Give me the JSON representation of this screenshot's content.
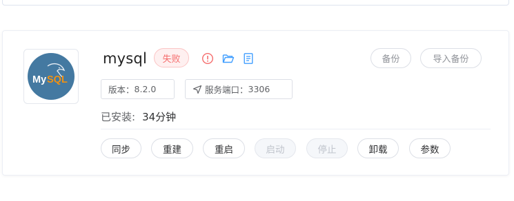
{
  "app": {
    "name": "mysql",
    "status": "失败",
    "logo_text": "MySQL",
    "version_label": "版本：",
    "version_value": "8.2.0",
    "port_label": "服务端口：",
    "port_value": "3306",
    "installed_label": "已安装:",
    "installed_value": "34分钟"
  },
  "header_buttons": {
    "backup": "备份",
    "import_backup": "导入备份"
  },
  "icons": {
    "error": "exclamation-circle-icon",
    "folder": "folder-open-icon",
    "document": "document-icon",
    "port": "location-arrow-icon"
  },
  "actions": [
    {
      "label": "同步",
      "disabled": false
    },
    {
      "label": "重建",
      "disabled": false
    },
    {
      "label": "重启",
      "disabled": false
    },
    {
      "label": "启动",
      "disabled": true
    },
    {
      "label": "停止",
      "disabled": true
    },
    {
      "label": "卸载",
      "disabled": false
    },
    {
      "label": "参数",
      "disabled": false
    }
  ],
  "colors": {
    "status_danger": "#f56c6c",
    "status_bg": "#fef0f0",
    "icon_primary": "#409eff",
    "logo_bg": "#4479a1",
    "logo_accent": "#f29111"
  }
}
